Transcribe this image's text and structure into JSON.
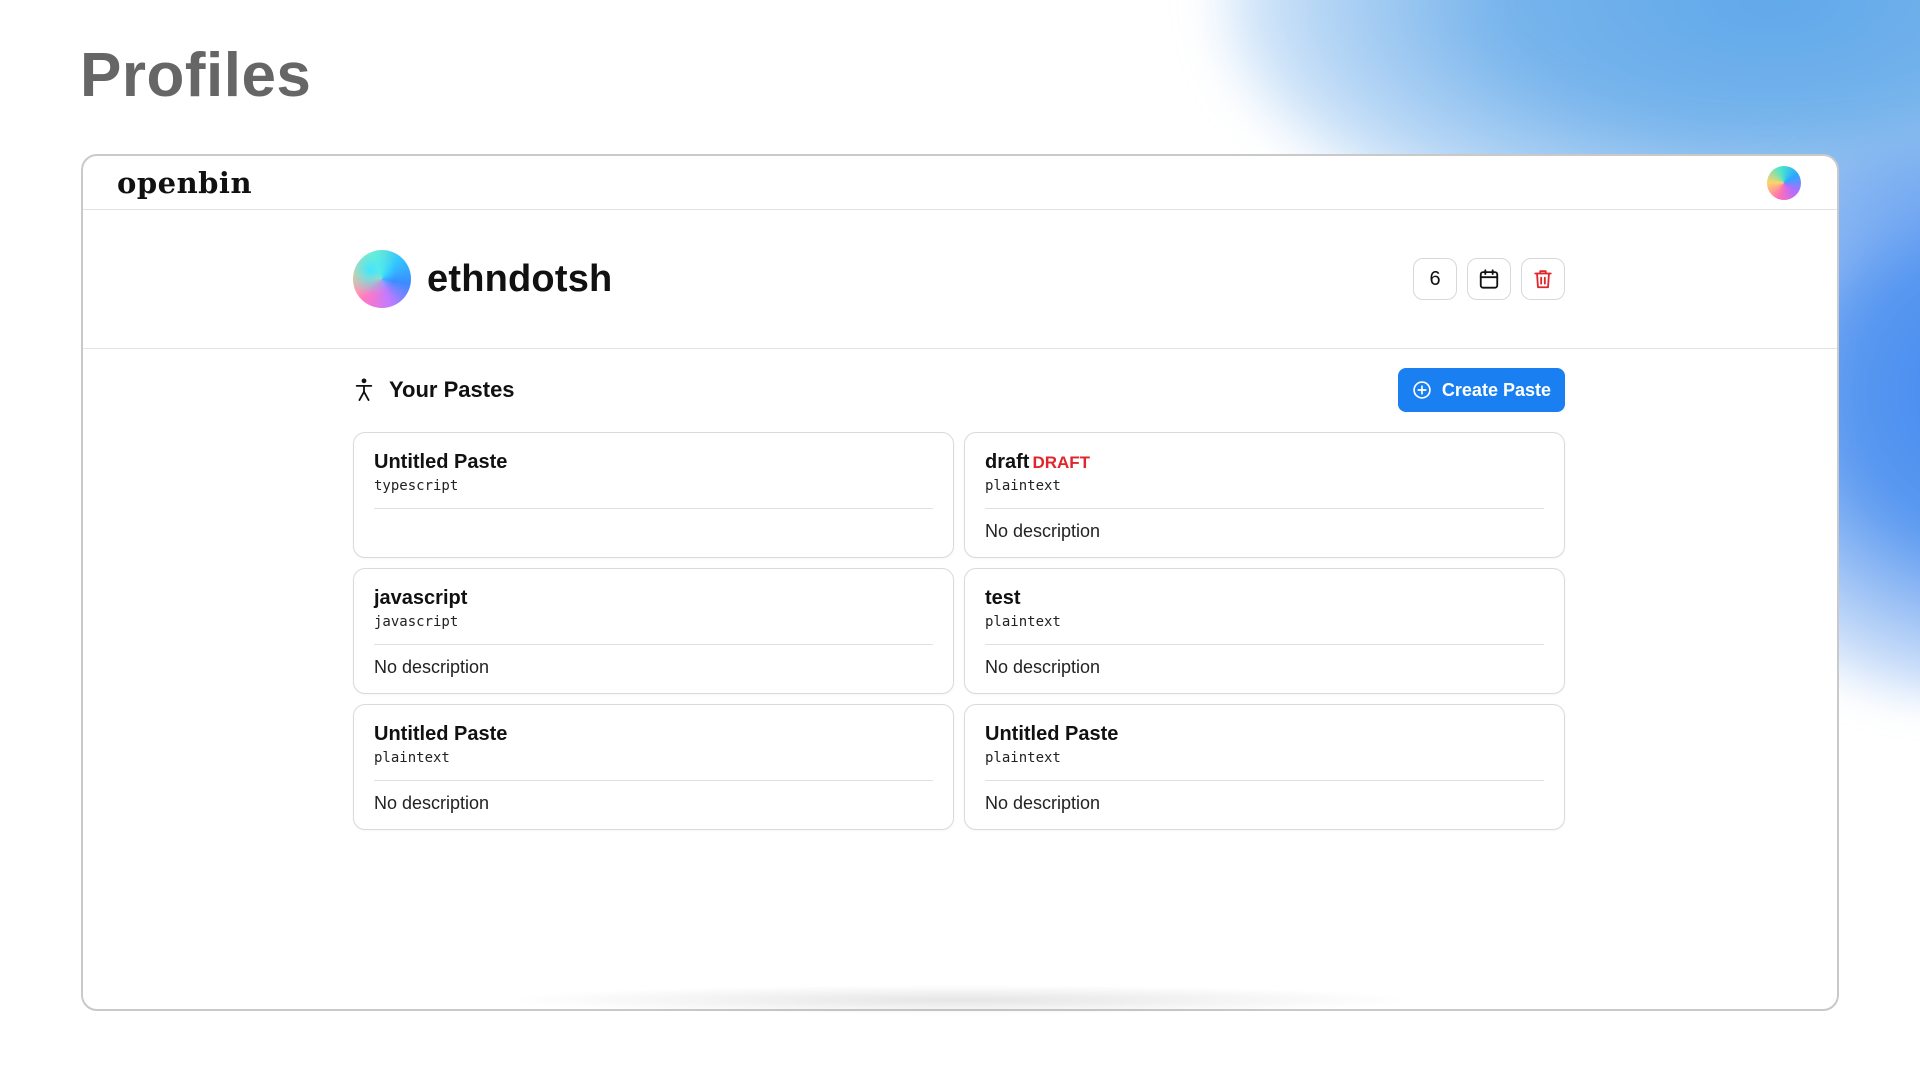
{
  "page": {
    "title": "Profiles"
  },
  "app": {
    "logo": "openbin"
  },
  "profile": {
    "username": "ethndotsh",
    "paste_count": "6"
  },
  "section": {
    "title": "Your Pastes",
    "create_label": "Create Paste"
  },
  "pastes": [
    {
      "title": "Untitled Paste",
      "draft": "",
      "language": "typescript",
      "description": ""
    },
    {
      "title": "draft",
      "draft": "DRAFT",
      "language": "plaintext",
      "description": "No description"
    },
    {
      "title": "javascript",
      "draft": "",
      "language": "javascript",
      "description": "No description"
    },
    {
      "title": "test",
      "draft": "",
      "language": "plaintext",
      "description": "No description"
    },
    {
      "title": "Untitled Paste",
      "draft": "",
      "language": "plaintext",
      "description": "No description"
    },
    {
      "title": "Untitled Paste",
      "draft": "",
      "language": "plaintext",
      "description": "No description"
    }
  ],
  "icons": {
    "calendar": "calendar-icon",
    "trash": "trash-icon",
    "accessibility": "person-icon",
    "plus": "plus-circle-icon"
  },
  "colors": {
    "accent": "#1a7ff0",
    "draft": "#e0262b",
    "delete": "#e0262b",
    "title_gray": "#666666"
  }
}
